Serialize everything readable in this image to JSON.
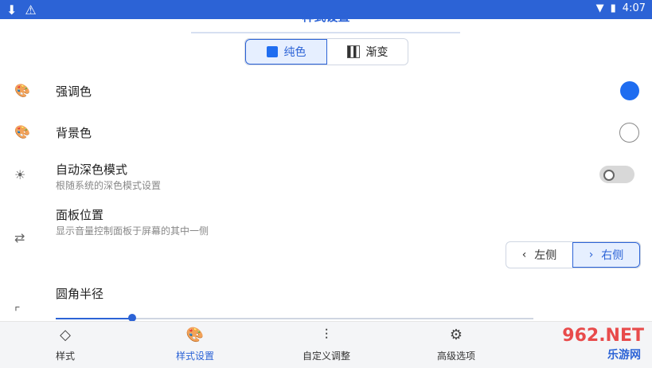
{
  "status": {
    "time": "4:07"
  },
  "header": {
    "title": "样式设置"
  },
  "mode_tabs": [
    {
      "label": "纯色",
      "active": true
    },
    {
      "label": "渐变",
      "active": false
    }
  ],
  "settings": {
    "accent": {
      "label": "强调色",
      "color": "#1f6df0"
    },
    "background": {
      "label": "背景色",
      "color": "#ffffff"
    },
    "auto_dark": {
      "label": "自动深色模式",
      "description": "根随系统的深色模式设置",
      "enabled": false
    },
    "panel_position": {
      "label": "面板位置",
      "description": "显示音量控制面板于屏幕的其中一侧",
      "options": [
        {
          "label": "左侧",
          "active": false
        },
        {
          "label": "右侧",
          "active": true
        }
      ]
    },
    "corner_radius": {
      "label": "圆角半径",
      "value_fraction": 0.16
    }
  },
  "bottom_nav": [
    {
      "label": "样式",
      "icon": "styles-icon",
      "active": false
    },
    {
      "label": "样式设置",
      "icon": "palette-icon",
      "active": true
    },
    {
      "label": "自定义调整",
      "icon": "sliders-icon",
      "active": false
    },
    {
      "label": "高级选项",
      "icon": "gear-icon",
      "active": false
    }
  ],
  "watermark": {
    "top": "962.NET",
    "bottom": "乐游网"
  }
}
